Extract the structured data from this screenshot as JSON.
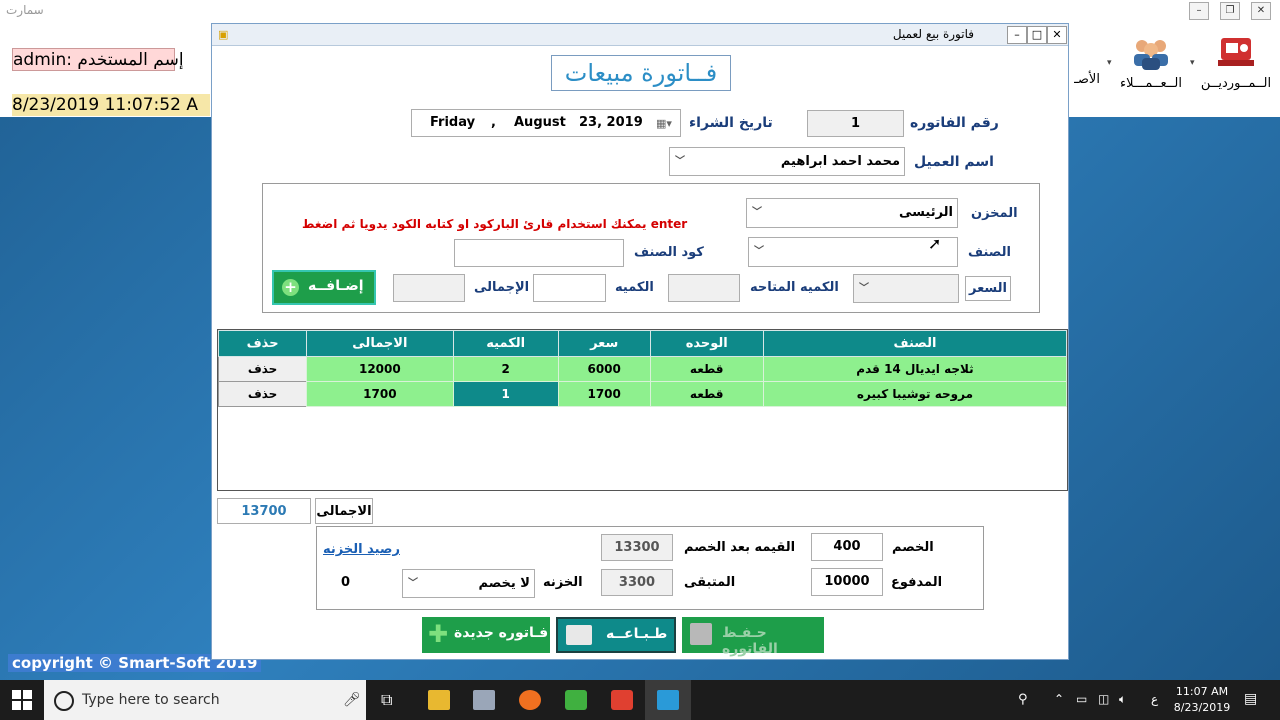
{
  "main_window": {
    "title": "سمارت",
    "user_label": "إسم المستخدم",
    "user_value": "admin:",
    "datetime": "8/23/2019 11:07:52 A",
    "copyright": "copyright © Smart-Soft  2019",
    "nav": [
      {
        "label": "الــمــورديــن"
      },
      {
        "label": "الــعــمـــلاء"
      },
      {
        "label": "الأصـ"
      }
    ]
  },
  "dialog": {
    "title": "فاتورة بيع لعميل",
    "heading": "فــاتورة مبيعات",
    "invoice_no_label": "رقم الفاتوره",
    "invoice_no": "1",
    "purchase_date_label": "تاريخ الشراء",
    "date": {
      "day": "Friday",
      "sep": ",",
      "month": "August",
      "daynum_year": "23, 2019"
    },
    "customer_label": "اسم العميل",
    "customer": "محمد احمد ابراهيم",
    "store_label": "المخزن",
    "store": "الرئيسى",
    "item_label": "الصنف",
    "item": "",
    "hint": "يمكنك استخدام قارئ الباركود او كتابه الكود يدويا ثم اضغط enter",
    "item_code_label": "كود الصنف",
    "price_label": "السعر",
    "available_qty_label": "الكميه المتاحه",
    "qty_label": "الكميه",
    "line_total_label": "الإجمالى",
    "add_button": "إضـافــه",
    "grid": {
      "headers": [
        "الصنف",
        "الوحده",
        "سعر",
        "الكميه",
        "الاجمالى",
        "حذف"
      ],
      "rows": [
        {
          "item": "ثلاجه ايديال 14 قدم",
          "unit": "قطعه",
          "price": "6000",
          "qty": "2",
          "total": "12000",
          "delete": "حذف"
        },
        {
          "item": "مروحه توشيبا كبيره",
          "unit": "قطعه",
          "price": "1700",
          "qty": "1",
          "total": "1700",
          "delete": "حذف"
        }
      ]
    },
    "total_label": "الاجمالى",
    "total_value": "13700",
    "discount_label": "الخصم",
    "discount_value": "400",
    "after_discount_label": "القيمه بعد الخصم",
    "after_discount_value": "13300",
    "treasury_balance_link": "رصيد الخزنه",
    "paid_label": "المدفوع",
    "paid_value": "10000",
    "remaining_label": "المتبقى",
    "remaining_value": "3300",
    "treasury_label": "الخزنه",
    "treasury_value": "لا يخصم",
    "treasury_balance": "0",
    "save_button": "حـفـظ الفاتوره",
    "print_button": "طـبـاعــه",
    "new_invoice_button": "فـاتوره جديدة"
  },
  "taskbar": {
    "search_placeholder": "Type here to search",
    "time": "11:07 AM",
    "date": "8/23/2019",
    "lang": "ع"
  },
  "colors": {
    "accent": "#0e8a8a",
    "row_green": "#8ef08e",
    "hint_red": "#d40000",
    "label_blue": "#1a3d7a"
  }
}
